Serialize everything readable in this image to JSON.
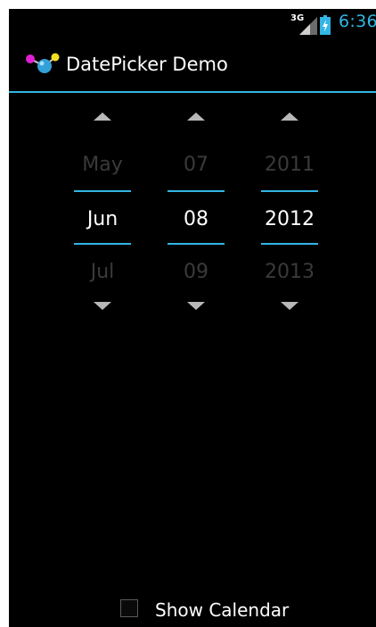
{
  "status_bar": {
    "network": "3G",
    "time": "6:36",
    "icons": [
      "signal-icon",
      "battery-icon"
    ]
  },
  "action_bar": {
    "title": "DatePicker Demo",
    "icon": "app-logo-icon"
  },
  "date_picker": {
    "month": {
      "prev": "May",
      "current": "Jun",
      "next": "Jul"
    },
    "day": {
      "prev": "07",
      "current": "08",
      "next": "09"
    },
    "year": {
      "prev": "2011",
      "current": "2012",
      "next": "2013"
    }
  },
  "show_calendar": {
    "label": "Show Calendar",
    "checked": false
  },
  "colors": {
    "accent": "#33b5e5",
    "background": "#000000",
    "text": "#ffffff",
    "dim_text": "#3a3a3a"
  }
}
